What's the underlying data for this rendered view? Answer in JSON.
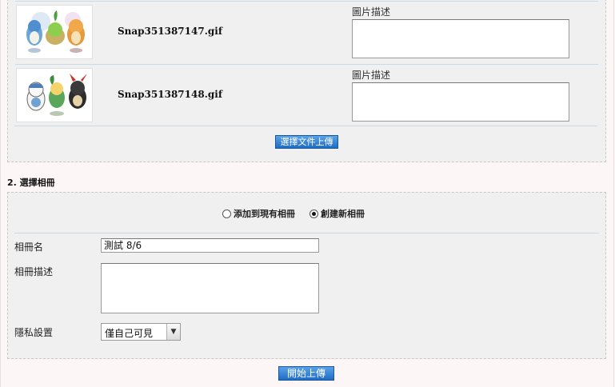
{
  "upload_files": [
    {
      "file_name": "Snap351387147.gif",
      "desc_label": "圖片描述",
      "desc_value": ""
    },
    {
      "file_name": "Snap351387148.gif",
      "desc_label": "圖片描述",
      "desc_value": ""
    }
  ],
  "select_files_button": "選擇文件上傳",
  "section2": {
    "title": "2. 選擇相冊",
    "radio_existing": "添加到現有相冊",
    "radio_new": "創建新相冊",
    "selected": "new",
    "album_name_label": "相冊名",
    "album_name_value": "測試 8/6",
    "album_desc_label": "相冊描述",
    "album_desc_value": "",
    "privacy_label": "隱私設置",
    "privacy_value": "僅自己可見"
  },
  "start_upload_button": "開始上傳"
}
